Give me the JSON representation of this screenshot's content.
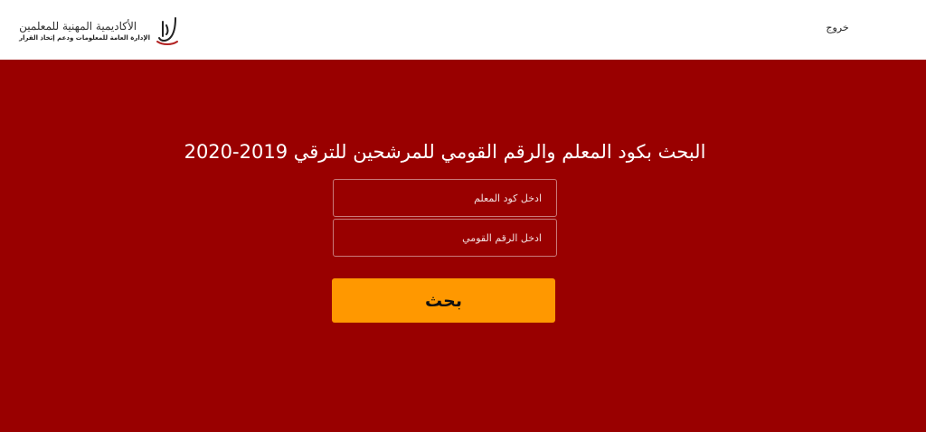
{
  "header": {
    "logo": {
      "line1": "الأكاديمية المهنية للمعلمين",
      "line2": "الإدارة العامة للمعلومات ودعم إتخاذ القرار"
    },
    "logout_label": "خروج"
  },
  "main": {
    "title": "البحث بكود المعلم والرقم القومي للمرشحين للترقي 2019-2020",
    "teacher_code_placeholder": "ادخل كود المعلم",
    "national_id_placeholder": "ادخل الرقم القومي",
    "search_label": "بحث"
  },
  "colors": {
    "background": "#990000",
    "header": "#ffffff",
    "button": "#ff9800"
  }
}
